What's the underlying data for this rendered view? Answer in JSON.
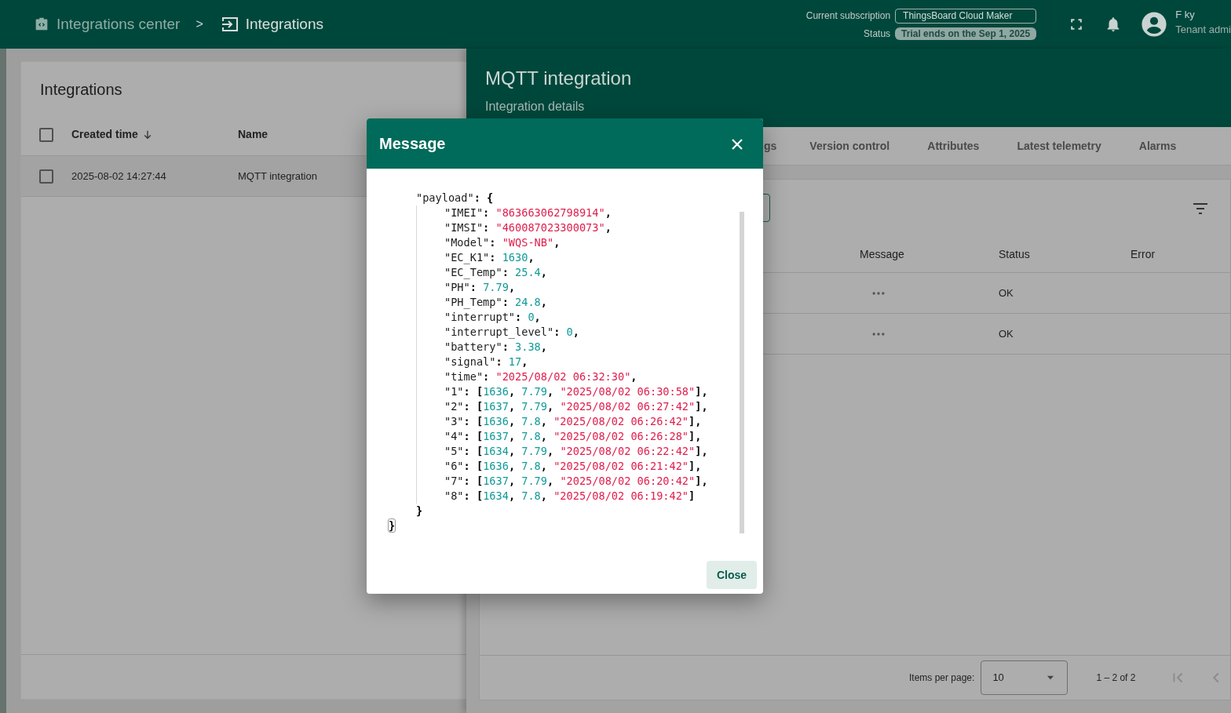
{
  "header": {
    "breadcrumbs": [
      {
        "label": "Integrations center",
        "current": false
      },
      {
        "label": "Integrations",
        "current": true
      }
    ],
    "separator": ">",
    "subscription": {
      "label": "Current subscription",
      "plan": "ThingsBoard Cloud Maker",
      "status_label": "Status",
      "status": "Trial ends on the Sep 1, 2025"
    },
    "user": {
      "name": "F ky",
      "role": "Tenant admi"
    }
  },
  "integrations_panel": {
    "title": "Integrations",
    "select_all_checked": false,
    "columns": [
      {
        "label": "Created time",
        "sorted": true
      },
      {
        "label": "Name",
        "sorted": false
      }
    ],
    "rows": [
      {
        "created_time": "2025-08-02 14:27:44",
        "name": "MQTT integration",
        "checked": false
      }
    ]
  },
  "details": {
    "title": "MQTT integration",
    "subtitle": "Integration details",
    "tabs": [
      {
        "label": "gs",
        "selected": false
      },
      {
        "label": "Version control",
        "selected": false
      },
      {
        "label": "Attributes",
        "selected": false
      },
      {
        "label": "Latest telemetry",
        "selected": false
      },
      {
        "label": "Alarms",
        "selected": false
      }
    ],
    "events": {
      "columns": [
        "Message",
        "Status",
        "Error"
      ],
      "rows": [
        {
          "status": "OK"
        },
        {
          "status": "OK"
        }
      ],
      "pagination": {
        "label": "Items per page:",
        "page_size": "10",
        "range": "1 – 2 of 2"
      }
    }
  },
  "dialog": {
    "title": "Message",
    "button": "Close",
    "code": {
      "children": [
        {
          "tokens": [
            {
              "kind": "k",
              "text": "\"payload\""
            },
            {
              "kind": "p",
              "text": ": {"
            }
          ],
          "children": [
            {
              "tokens": [
                {
                  "kind": "k",
                  "text": "\"IMEI\""
                },
                {
                  "kind": "p",
                  "text": ": "
                },
                {
                  "kind": "s",
                  "text": "\"863663062798914\""
                },
                {
                  "kind": "p",
                  "text": ","
                }
              ]
            },
            {
              "tokens": [
                {
                  "kind": "k",
                  "text": "\"IMSI\""
                },
                {
                  "kind": "p",
                  "text": ": "
                },
                {
                  "kind": "s",
                  "text": "\"460087023300073\""
                },
                {
                  "kind": "p",
                  "text": ","
                }
              ]
            },
            {
              "tokens": [
                {
                  "kind": "k",
                  "text": "\"Model\""
                },
                {
                  "kind": "p",
                  "text": ": "
                },
                {
                  "kind": "s",
                  "text": "\"WQS-NB\""
                },
                {
                  "kind": "p",
                  "text": ","
                }
              ]
            },
            {
              "tokens": [
                {
                  "kind": "k",
                  "text": "\"EC_K1\""
                },
                {
                  "kind": "p",
                  "text": ": "
                },
                {
                  "kind": "n",
                  "text": "1630"
                },
                {
                  "kind": "p",
                  "text": ","
                }
              ]
            },
            {
              "tokens": [
                {
                  "kind": "k",
                  "text": "\"EC_Temp\""
                },
                {
                  "kind": "p",
                  "text": ": "
                },
                {
                  "kind": "n",
                  "text": "25.4"
                },
                {
                  "kind": "p",
                  "text": ","
                }
              ]
            },
            {
              "tokens": [
                {
                  "kind": "k",
                  "text": "\"PH\""
                },
                {
                  "kind": "p",
                  "text": ": "
                },
                {
                  "kind": "n",
                  "text": "7.79"
                },
                {
                  "kind": "p",
                  "text": ","
                }
              ]
            },
            {
              "tokens": [
                {
                  "kind": "k",
                  "text": "\"PH_Temp\""
                },
                {
                  "kind": "p",
                  "text": ": "
                },
                {
                  "kind": "n",
                  "text": "24.8"
                },
                {
                  "kind": "p",
                  "text": ","
                }
              ]
            },
            {
              "tokens": [
                {
                  "kind": "k",
                  "text": "\"interrupt\""
                },
                {
                  "kind": "p",
                  "text": ": "
                },
                {
                  "kind": "n",
                  "text": "0"
                },
                {
                  "kind": "p",
                  "text": ","
                }
              ]
            },
            {
              "tokens": [
                {
                  "kind": "k",
                  "text": "\"interrupt_level\""
                },
                {
                  "kind": "p",
                  "text": ": "
                },
                {
                  "kind": "n",
                  "text": "0"
                },
                {
                  "kind": "p",
                  "text": ","
                }
              ]
            },
            {
              "tokens": [
                {
                  "kind": "k",
                  "text": "\"battery\""
                },
                {
                  "kind": "p",
                  "text": ": "
                },
                {
                  "kind": "n",
                  "text": "3.38"
                },
                {
                  "kind": "p",
                  "text": ","
                }
              ]
            },
            {
              "tokens": [
                {
                  "kind": "k",
                  "text": "\"signal\""
                },
                {
                  "kind": "p",
                  "text": ": "
                },
                {
                  "kind": "n",
                  "text": "17"
                },
                {
                  "kind": "p",
                  "text": ","
                }
              ]
            },
            {
              "tokens": [
                {
                  "kind": "k",
                  "text": "\"time\""
                },
                {
                  "kind": "p",
                  "text": ": "
                },
                {
                  "kind": "s",
                  "text": "\"2025/08/02 06:32:30\""
                },
                {
                  "kind": "p",
                  "text": ","
                }
              ]
            },
            {
              "tokens": [
                {
                  "kind": "k",
                  "text": "\"1\""
                },
                {
                  "kind": "p",
                  "text": ": ["
                },
                {
                  "kind": "n",
                  "text": "1636"
                },
                {
                  "kind": "p",
                  "text": ", "
                },
                {
                  "kind": "n",
                  "text": "7.79"
                },
                {
                  "kind": "p",
                  "text": ", "
                },
                {
                  "kind": "s",
                  "text": "\"2025/08/02 06:30:58\""
                },
                {
                  "kind": "p",
                  "text": "],"
                }
              ]
            },
            {
              "tokens": [
                {
                  "kind": "k",
                  "text": "\"2\""
                },
                {
                  "kind": "p",
                  "text": ": ["
                },
                {
                  "kind": "n",
                  "text": "1637"
                },
                {
                  "kind": "p",
                  "text": ", "
                },
                {
                  "kind": "n",
                  "text": "7.79"
                },
                {
                  "kind": "p",
                  "text": ", "
                },
                {
                  "kind": "s",
                  "text": "\"2025/08/02 06:27:42\""
                },
                {
                  "kind": "p",
                  "text": "],"
                }
              ]
            },
            {
              "tokens": [
                {
                  "kind": "k",
                  "text": "\"3\""
                },
                {
                  "kind": "p",
                  "text": ": ["
                },
                {
                  "kind": "n",
                  "text": "1636"
                },
                {
                  "kind": "p",
                  "text": ", "
                },
                {
                  "kind": "n",
                  "text": "7.8"
                },
                {
                  "kind": "p",
                  "text": ", "
                },
                {
                  "kind": "s",
                  "text": "\"2025/08/02 06:26:42\""
                },
                {
                  "kind": "p",
                  "text": "],"
                }
              ]
            },
            {
              "tokens": [
                {
                  "kind": "k",
                  "text": "\"4\""
                },
                {
                  "kind": "p",
                  "text": ": ["
                },
                {
                  "kind": "n",
                  "text": "1637"
                },
                {
                  "kind": "p",
                  "text": ", "
                },
                {
                  "kind": "n",
                  "text": "7.8"
                },
                {
                  "kind": "p",
                  "text": ", "
                },
                {
                  "kind": "s",
                  "text": "\"2025/08/02 06:26:28\""
                },
                {
                  "kind": "p",
                  "text": "],"
                }
              ]
            },
            {
              "tokens": [
                {
                  "kind": "k",
                  "text": "\"5\""
                },
                {
                  "kind": "p",
                  "text": ": ["
                },
                {
                  "kind": "n",
                  "text": "1634"
                },
                {
                  "kind": "p",
                  "text": ", "
                },
                {
                  "kind": "n",
                  "text": "7.79"
                },
                {
                  "kind": "p",
                  "text": ", "
                },
                {
                  "kind": "s",
                  "text": "\"2025/08/02 06:22:42\""
                },
                {
                  "kind": "p",
                  "text": "],"
                }
              ]
            },
            {
              "tokens": [
                {
                  "kind": "k",
                  "text": "\"6\""
                },
                {
                  "kind": "p",
                  "text": ": ["
                },
                {
                  "kind": "n",
                  "text": "1636"
                },
                {
                  "kind": "p",
                  "text": ", "
                },
                {
                  "kind": "n",
                  "text": "7.8"
                },
                {
                  "kind": "p",
                  "text": ", "
                },
                {
                  "kind": "s",
                  "text": "\"2025/08/02 06:21:42\""
                },
                {
                  "kind": "p",
                  "text": "],"
                }
              ]
            },
            {
              "tokens": [
                {
                  "kind": "k",
                  "text": "\"7\""
                },
                {
                  "kind": "p",
                  "text": ": ["
                },
                {
                  "kind": "n",
                  "text": "1637"
                },
                {
                  "kind": "p",
                  "text": ", "
                },
                {
                  "kind": "n",
                  "text": "7.79"
                },
                {
                  "kind": "p",
                  "text": ", "
                },
                {
                  "kind": "s",
                  "text": "\"2025/08/02 06:20:42\""
                },
                {
                  "kind": "p",
                  "text": "],"
                }
              ]
            },
            {
              "tokens": [
                {
                  "kind": "k",
                  "text": "\"8\""
                },
                {
                  "kind": "p",
                  "text": ": ["
                },
                {
                  "kind": "n",
                  "text": "1634"
                },
                {
                  "kind": "p",
                  "text": ", "
                },
                {
                  "kind": "n",
                  "text": "7.8"
                },
                {
                  "kind": "p",
                  "text": ", "
                },
                {
                  "kind": "s",
                  "text": "\"2025/08/02 06:19:42\""
                },
                {
                  "kind": "p",
                  "text": "]"
                }
              ]
            }
          ]
        },
        {
          "tokens": [
            {
              "kind": "p",
              "text": "}"
            }
          ]
        }
      ],
      "after": [
        {
          "tokens": [
            {
              "kind": "p",
              "text": "}"
            }
          ],
          "highlighted": true
        }
      ]
    }
  }
}
